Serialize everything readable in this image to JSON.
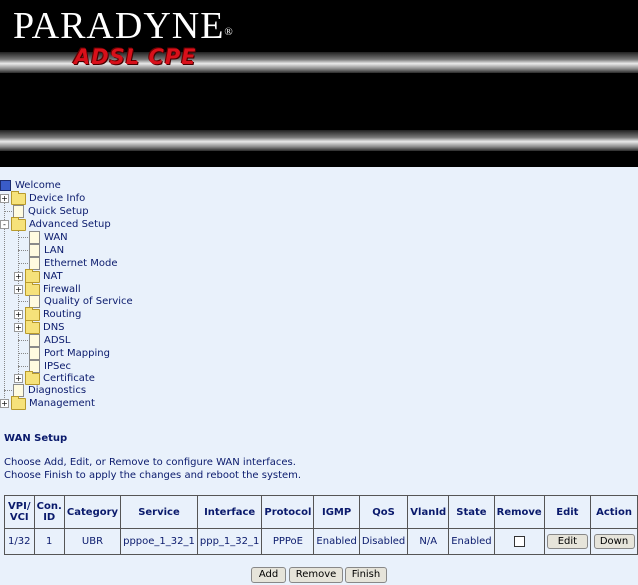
{
  "header": {
    "brand": "PARADYNE",
    "registered": "®",
    "product": "ADSL CPE"
  },
  "tree": {
    "welcome": "Welcome",
    "device_info": "Device Info",
    "quick_setup": "Quick Setup",
    "advanced_setup": "Advanced Setup",
    "wan": "WAN",
    "lan": "LAN",
    "ethernet_mode": "Ethernet Mode",
    "nat": "NAT",
    "firewall": "Firewall",
    "qos": "Quality of Service",
    "routing": "Routing",
    "dns": "DNS",
    "adsl": "ADSL",
    "port_mapping": "Port Mapping",
    "ipsec": "IPSec",
    "certificate": "Certificate",
    "diagnostics": "Diagnostics",
    "management": "Management",
    "expander_collapsed": "+",
    "expander_expanded": "-"
  },
  "page": {
    "title": "WAN Setup",
    "instruction1": "Choose Add, Edit, or Remove to configure WAN interfaces.",
    "instruction2": "Choose Finish to apply the changes and reboot the system."
  },
  "table": {
    "headers": {
      "vpi_vci": [
        "VPI/",
        "VCI"
      ],
      "con_id": [
        "Con.",
        "ID"
      ],
      "category": "Category",
      "service": "Service",
      "interface": "Interface",
      "protocol": "Protocol",
      "igmp": "IGMP",
      "qos": "QoS",
      "vlanid": "VlanId",
      "state": "State",
      "remove": "Remove",
      "edit": "Edit",
      "action": "Action"
    },
    "rows": [
      {
        "vpi_vci": "1/32",
        "con_id": "1",
        "category": "UBR",
        "service": "pppoe_1_32_1",
        "interface": "ppp_1_32_1",
        "protocol": "PPPoE",
        "igmp": "Enabled",
        "qos": "Disabled",
        "vlanid": "N/A",
        "state": "Enabled",
        "remove_checked": false,
        "edit_label": "Edit",
        "action_label": "Down"
      }
    ]
  },
  "buttons": {
    "add": "Add",
    "remove": "Remove",
    "finish": "Finish"
  }
}
